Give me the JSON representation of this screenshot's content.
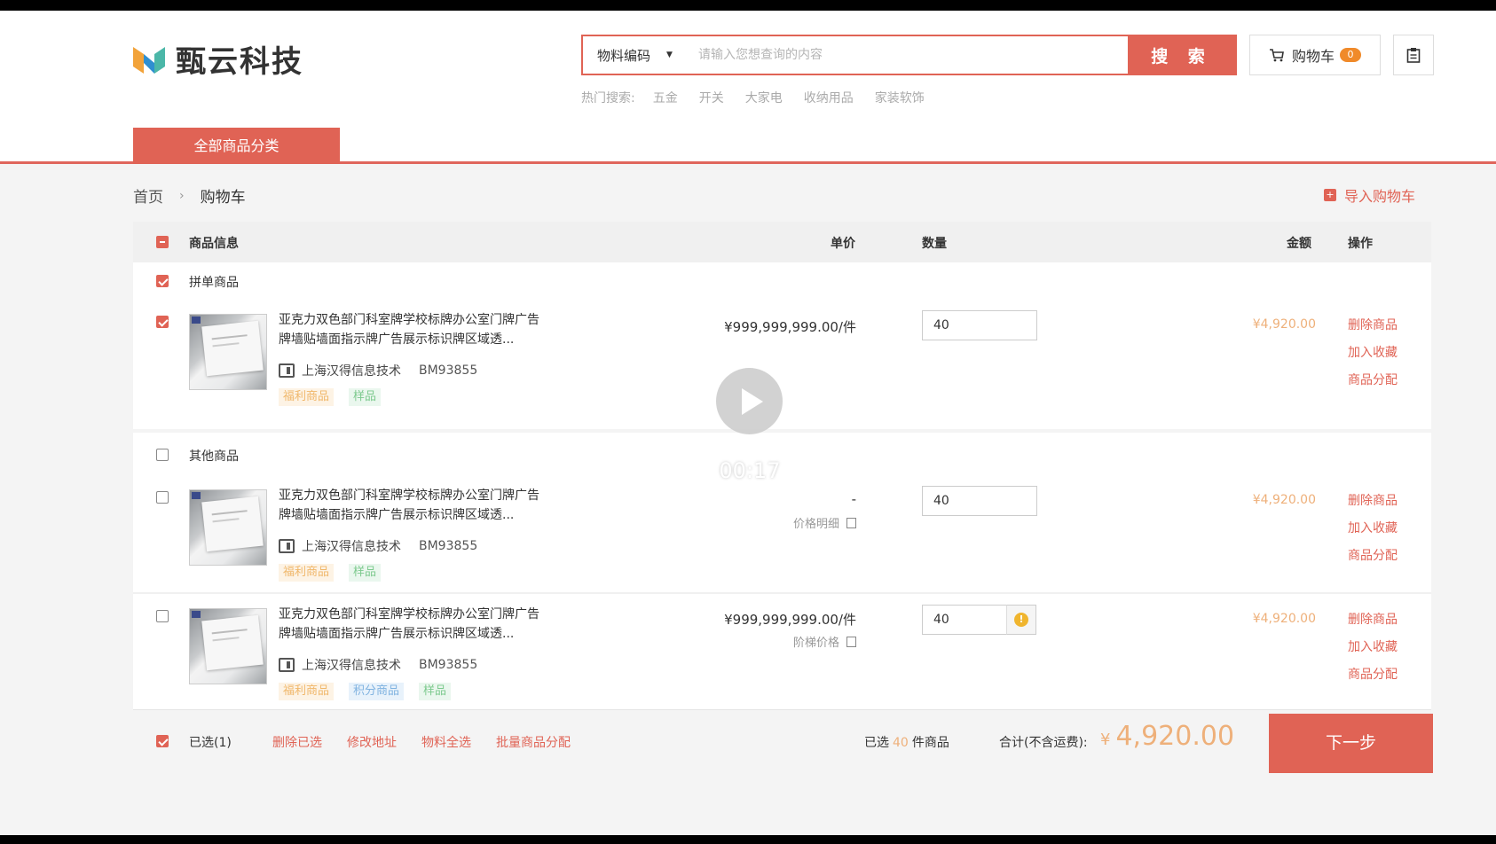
{
  "brand": {
    "name": "甄云科技",
    "accent": "#e06355"
  },
  "search": {
    "type_label": "物料编码",
    "placeholder": "请输入您想查询的内容",
    "button_label": "搜 索",
    "hot_label": "热门搜索:",
    "hot_terms": [
      "五金",
      "开关",
      "大家电",
      "收纳用品",
      "家装软饰"
    ]
  },
  "cart": {
    "label": "购物车",
    "count": "0"
  },
  "category_tab": "全部商品分类",
  "breadcrumb": {
    "home": "首页",
    "separator": "›",
    "current": "购物车"
  },
  "import_label": "导入购物车",
  "table_headers": {
    "product": "商品信息",
    "unit_price": "单价",
    "quantity": "数量",
    "amount": "金额",
    "actions": "操作"
  },
  "groups": [
    {
      "label": "拼单商品",
      "checked": true,
      "items": [
        {
          "checked": true,
          "name": "亚克力双色部门科室牌学校标牌办公室门牌广告牌墙贴墙面指示牌广告展示标识牌区域透...",
          "supplier": "上海汉得信息技术",
          "code": "BM93855",
          "tags": [
            "福利商品",
            "样品"
          ],
          "price": "¥999,999,999.00/件",
          "price_note": "",
          "quantity": "40",
          "amount": "¥4,920.00",
          "actions": [
            "删除商品",
            "加入收藏",
            "商品分配"
          ]
        }
      ]
    },
    {
      "label": "其他商品",
      "checked": false,
      "items": [
        {
          "checked": false,
          "name": "亚克力双色部门科室牌学校标牌办公室门牌广告牌墙贴墙面指示牌广告展示标识牌区域透...",
          "supplier": "上海汉得信息技术",
          "code": "BM93855",
          "tags": [
            "福利商品",
            "样品"
          ],
          "price": "-",
          "price_note": "价格明细",
          "quantity": "40",
          "amount": "¥4,920.00",
          "actions": [
            "删除商品",
            "加入收藏",
            "商品分配"
          ]
        },
        {
          "checked": false,
          "name": "亚克力双色部门科室牌学校标牌办公室门牌广告牌墙贴墙面指示牌广告展示标识牌区域透...",
          "supplier": "上海汉得信息技术",
          "code": "BM93855",
          "tags": [
            "福利商品",
            "积分商品",
            "样品"
          ],
          "price": "¥999,999,999.00/件",
          "price_note": "阶梯价格",
          "quantity": "40",
          "amount": "¥4,920.00",
          "actions": [
            "删除商品",
            "加入收藏",
            "商品分配"
          ]
        }
      ]
    }
  ],
  "footer": {
    "selected_label": "已选(1)",
    "links": [
      "删除已选",
      "修改地址",
      "物料全选",
      "批量商品分配"
    ],
    "count_prefix": "已选",
    "count": "40",
    "count_suffix": "件商品",
    "total_label": "合计(不含运费):",
    "currency": "¥",
    "total": "4,920.00",
    "next_label": "下一步"
  },
  "video": {
    "time": "00:17"
  }
}
